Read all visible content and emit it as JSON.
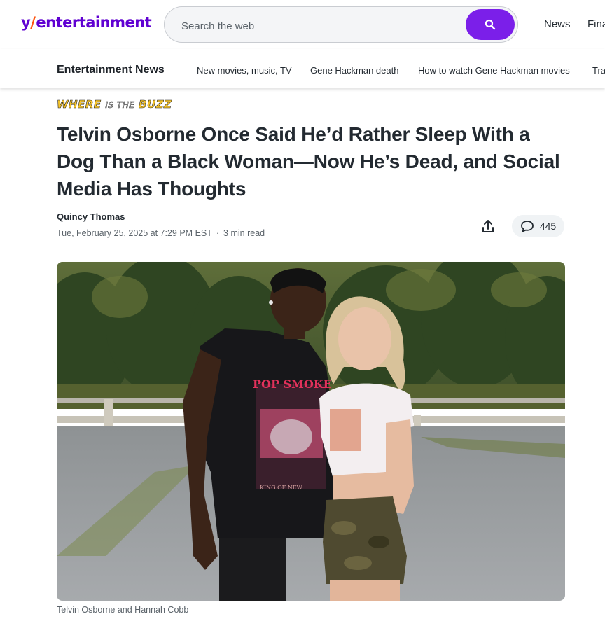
{
  "header": {
    "logo": {
      "mark": "y",
      "slash": "/",
      "rest": "entertainment"
    },
    "search": {
      "placeholder": "Search the web"
    },
    "nav": [
      "News",
      "Fina"
    ]
  },
  "subnav": {
    "title": "Entertainment News",
    "links": [
      "New movies, music, TV",
      "Gene Hackman death",
      "How to watch Gene Hackman movies",
      "Tra"
    ]
  },
  "article": {
    "badge": {
      "part1": "WHERE",
      "part2": "IS THE",
      "part3": "BUZZ"
    },
    "headline": "Telvin Osborne Once Said He’d Rather Sleep With a Dog Than a Black Woman—Now He’s Dead, and Social Media Has Thoughts",
    "author": "Quincy Thomas",
    "date": "Tue, February 25, 2025 at 7:29 PM EST",
    "read_time": "3 min read",
    "comment_count": "445",
    "photo_shirt_text": "POP SMOKE",
    "photo_shirt_subtext": "KING OF NEW",
    "caption": "Telvin Osborne and Hannah Cobb"
  },
  "colors": {
    "brand": "#6001d2",
    "search_button": "#7b1fe9",
    "logo_slash": "#ff520d"
  },
  "icons": [
    "search-icon",
    "share-icon",
    "comment-icon"
  ]
}
